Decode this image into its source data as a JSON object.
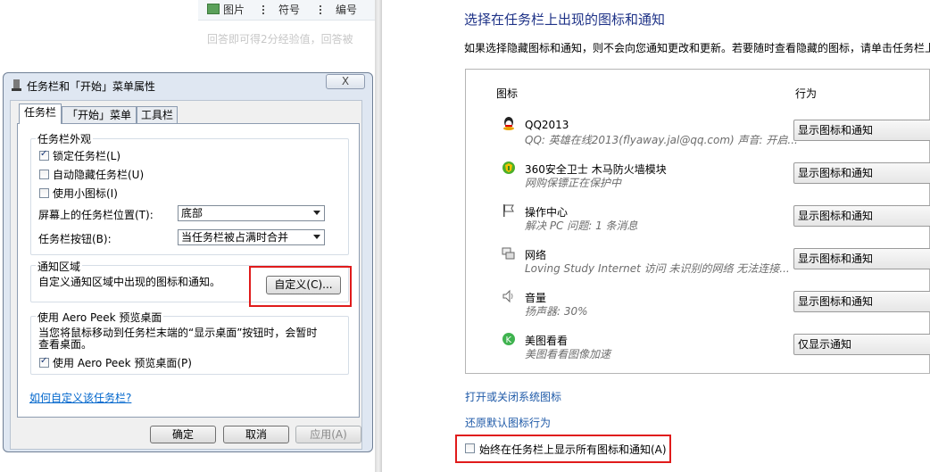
{
  "web": {
    "toolbar": {
      "picture": "图片",
      "symbol": "符号",
      "number": "编号"
    },
    "hint": "回答即可得2分经验值，回答被"
  },
  "dialog": {
    "title": "任务栏和「开始」菜单属性",
    "close": "X",
    "tabs": [
      "任务栏",
      "「开始」菜单",
      "工具栏"
    ],
    "appearance": {
      "title": "任务栏外观",
      "lock": "锁定任务栏(L)",
      "autohide": "自动隐藏任务栏(U)",
      "small_icons": "使用小图标(I)",
      "position_label": "屏幕上的任务栏位置(T):",
      "position_value": "底部",
      "buttons_label": "任务栏按钮(B):",
      "buttons_value": "当任务栏被占满时合并"
    },
    "notify": {
      "title": "通知区域",
      "desc": "自定义通知区域中出现的图标和通知。",
      "customize": "自定义(C)..."
    },
    "peek": {
      "title": "使用 Aero Peek 预览桌面",
      "desc_line1": "当您将鼠标移动到任务栏末端的“显示桌面”按钮时，会暂时",
      "desc_line2": "查看桌面。",
      "checkbox": "使用 Aero Peek 预览桌面(P)"
    },
    "help_link": "如何自定义该任务栏?",
    "ok": "确定",
    "cancel": "取消",
    "apply": "应用(A)"
  },
  "panel": {
    "title": "选择在任务栏上出现的图标和通知",
    "desc": "如果选择隐藏图标和通知，则不会向您通知更改和更新。若要随时查看隐藏的图标，请单击任务栏上",
    "col_icon": "图标",
    "col_behavior": "行为",
    "rows": [
      {
        "name": "QQ2013",
        "sub": "QQ: 英雄在线2013(flyaway.jal@qq.com)  声音: 开启...",
        "behavior": "显示图标和通知",
        "icon": "qq-icon"
      },
      {
        "name": "360安全卫士 木马防火墙模块",
        "sub": "网购保镖正在保护中",
        "behavior": "显示图标和通知",
        "icon": "360-shield-icon"
      },
      {
        "name": "操作中心",
        "sub": "解决 PC 问题: 1 条消息",
        "behavior": "显示图标和通知",
        "icon": "flag-icon"
      },
      {
        "name": "网络",
        "sub": "Loving Study Internet 访问  未识别的网络  无法连接...",
        "behavior": "显示图标和通知",
        "icon": "network-icon"
      },
      {
        "name": "音量",
        "sub": "扬声器: 30%",
        "behavior": "显示图标和通知",
        "icon": "speaker-icon"
      },
      {
        "name": "美图看看",
        "sub": "美图看看图像加速",
        "behavior": "仅显示通知",
        "icon": "meitu-icon"
      }
    ],
    "link_system_icons": "打开或关闭系统图标",
    "link_restore": "还原默认图标行为",
    "always_show": "始终在任务栏上显示所有图标和通知(A)"
  },
  "colors": {
    "highlight_box": "#e01b1b",
    "title_blue": "#1e3287",
    "link_blue": "#0066cc"
  }
}
